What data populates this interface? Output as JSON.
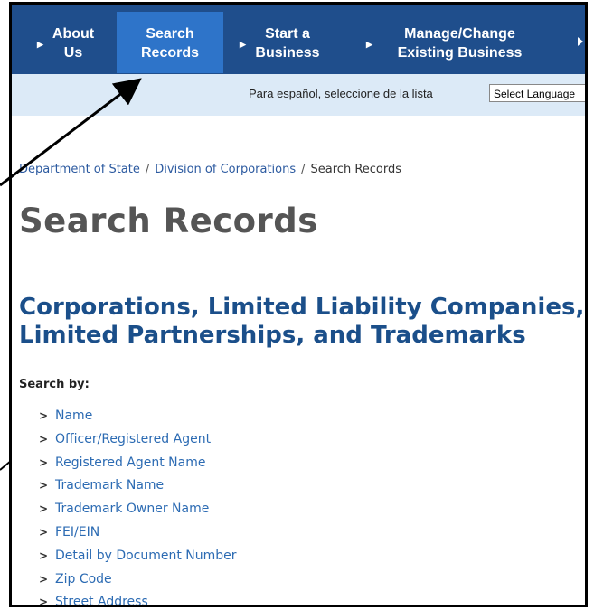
{
  "nav": {
    "items": [
      {
        "label": "About\nUs"
      },
      {
        "label": "Search\nRecords"
      },
      {
        "label": "Start a\nBusiness"
      },
      {
        "label": "Manage/Change\nExisting Business"
      }
    ],
    "active_color": "#2e74c9",
    "bar_color": "#1f4e8c"
  },
  "language": {
    "prompt": "Para español, seleccione de la lista",
    "select_value": "Select Language"
  },
  "breadcrumb": {
    "items": [
      "Department of State",
      "Division of Corporations",
      "Search Records"
    ]
  },
  "page": {
    "title": "Search Records",
    "section_title": "Corporations, Limited Liability Companies, Limited Partnerships, and Trademarks",
    "search_by_label": "Search by:"
  },
  "search_links": [
    "Name",
    "Officer/Registered Agent",
    "Registered Agent Name",
    "Trademark Name",
    "Trademark Owner Name",
    "FEI/EIN",
    "Detail by Document Number",
    "Zip Code",
    "Street Address"
  ]
}
